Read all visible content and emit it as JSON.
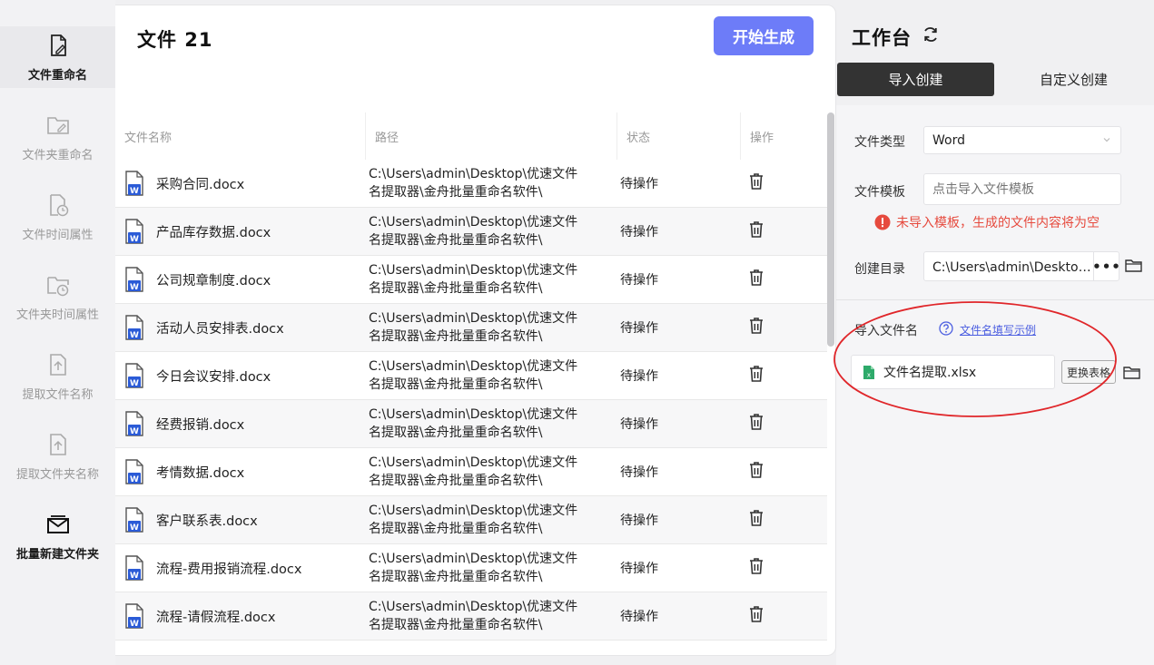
{
  "sidebar": {
    "items": [
      {
        "label": "文件重命名",
        "icon": "file-edit-icon",
        "state": "active"
      },
      {
        "label": "文件夹重命名",
        "icon": "folder-edit-icon",
        "state": "normal"
      },
      {
        "label": "文件时间属性",
        "icon": "file-clock-icon",
        "state": "normal"
      },
      {
        "label": "文件夹时间属性",
        "icon": "folder-clock-icon",
        "state": "normal"
      },
      {
        "label": "提取文件名称",
        "icon": "file-extract-icon",
        "state": "normal"
      },
      {
        "label": "提取文件夹名称",
        "icon": "folder-extract-icon",
        "state": "normal"
      },
      {
        "label": "批量新建文件夹",
        "icon": "mail-folder-icon",
        "state": "bold"
      }
    ]
  },
  "main": {
    "title": "文件 21",
    "generate_button": "开始生成",
    "columns": [
      "文件名称",
      "路径",
      "状态",
      "操作"
    ],
    "rows": [
      {
        "name": "采购合同.docx",
        "path1": "C:\\Users\\admin\\Desktop\\优速文件",
        "path2": "名提取器\\金舟批量重命名软件\\",
        "status": "待操作"
      },
      {
        "name": "产品库存数据.docx",
        "path1": "C:\\Users\\admin\\Desktop\\优速文件",
        "path2": "名提取器\\金舟批量重命名软件\\",
        "status": "待操作"
      },
      {
        "name": "公司规章制度.docx",
        "path1": "C:\\Users\\admin\\Desktop\\优速文件",
        "path2": "名提取器\\金舟批量重命名软件\\",
        "status": "待操作"
      },
      {
        "name": "活动人员安排表.docx",
        "path1": "C:\\Users\\admin\\Desktop\\优速文件",
        "path2": "名提取器\\金舟批量重命名软件\\",
        "status": "待操作"
      },
      {
        "name": "今日会议安排.docx",
        "path1": "C:\\Users\\admin\\Desktop\\优速文件",
        "path2": "名提取器\\金舟批量重命名软件\\",
        "status": "待操作"
      },
      {
        "name": "经费报销.docx",
        "path1": "C:\\Users\\admin\\Desktop\\优速文件",
        "path2": "名提取器\\金舟批量重命名软件\\",
        "status": "待操作"
      },
      {
        "name": "考情数据.docx",
        "path1": "C:\\Users\\admin\\Desktop\\优速文件",
        "path2": "名提取器\\金舟批量重命名软件\\",
        "status": "待操作"
      },
      {
        "name": "客户联系表.docx",
        "path1": "C:\\Users\\admin\\Desktop\\优速文件",
        "path2": "名提取器\\金舟批量重命名软件\\",
        "status": "待操作"
      },
      {
        "name": "流程-费用报销流程.docx",
        "path1": "C:\\Users\\admin\\Desktop\\优速文件",
        "path2": "名提取器\\金舟批量重命名软件\\",
        "status": "待操作"
      },
      {
        "name": "流程-请假流程.docx",
        "path1": "C:\\Users\\admin\\Desktop\\优速文件",
        "path2": "名提取器\\金舟批量重命名软件\\",
        "status": "待操作"
      }
    ]
  },
  "workbench": {
    "title": "工作台",
    "tabs": [
      "导入创建",
      "自定义创建"
    ],
    "file_type_label": "文件类型",
    "file_type_value": "Word",
    "template_label": "文件模板",
    "template_placeholder": "点击导入文件模板",
    "warning": "未导入模板，生成的文件内容将为空",
    "dir_label": "创建目录",
    "dir_value": "C:\\Users\\admin\\Desktop\\优速文件名提取器",
    "dots": "•••",
    "import_label": "导入文件名",
    "help_link": "文件名填写示例",
    "import_file": "文件名提取.xlsx",
    "swap_button": "更换表格"
  },
  "colors": {
    "accent": "#6d7cf8",
    "warning": "#e64a3e",
    "word_blue": "#2b5bd7",
    "excel_green": "#2eaa6a",
    "annotation_red": "#e0262a"
  }
}
